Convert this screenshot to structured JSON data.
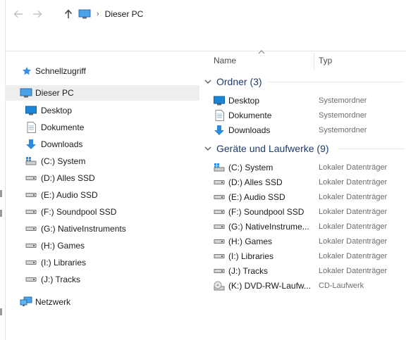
{
  "toolbar": {
    "back_label": "←",
    "forward_label": "→",
    "up_label": "↑",
    "separator": "›",
    "breadcrumb": "Dieser PC"
  },
  "nav": {
    "quick_access": "Schnellzugriff",
    "this_pc": "Dieser PC",
    "items": [
      {
        "label": "Desktop",
        "icon": "desktop-icon"
      },
      {
        "label": "Dokumente",
        "icon": "document-icon"
      },
      {
        "label": "Downloads",
        "icon": "download-icon"
      },
      {
        "label": "(C:) System",
        "icon": "system-drive-icon"
      },
      {
        "label": "(D:) Alles SSD",
        "icon": "drive-icon"
      },
      {
        "label": "(E:) Audio SSD",
        "icon": "drive-icon"
      },
      {
        "label": "(F:) Soundpool SSD",
        "icon": "drive-icon"
      },
      {
        "label": "(G:) NativeInstruments",
        "icon": "drive-icon"
      },
      {
        "label": "(H:) Games",
        "icon": "drive-icon"
      },
      {
        "label": "(I:) Libraries",
        "icon": "drive-icon"
      },
      {
        "label": "(J:) Tracks",
        "icon": "drive-icon"
      }
    ],
    "network": "Netzwerk"
  },
  "columns": {
    "name": "Name",
    "type": "Typ"
  },
  "groups": {
    "folders": {
      "title": "Ordner (3)",
      "rows": [
        {
          "name": "Desktop",
          "type": "Systemordner",
          "icon": "desktop-icon"
        },
        {
          "name": "Dokumente",
          "type": "Systemordner",
          "icon": "document-icon"
        },
        {
          "name": "Downloads",
          "type": "Systemordner",
          "icon": "download-icon"
        }
      ]
    },
    "drives": {
      "title": "Geräte und Laufwerke (9)",
      "rows": [
        {
          "name": "(C:) System",
          "type": "Lokaler Datenträger",
          "icon": "system-drive-icon"
        },
        {
          "name": "(D:) Alles SSD",
          "type": "Lokaler Datenträger",
          "icon": "drive-icon"
        },
        {
          "name": "(E:) Audio SSD",
          "type": "Lokaler Datenträger",
          "icon": "drive-icon"
        },
        {
          "name": "(F:) Soundpool SSD",
          "type": "Lokaler Datenträger",
          "icon": "drive-icon"
        },
        {
          "name": "(G:) NativeInstrume...",
          "type": "Lokaler Datenträger",
          "icon": "drive-icon"
        },
        {
          "name": "(H:) Games",
          "type": "Lokaler Datenträger",
          "icon": "drive-icon"
        },
        {
          "name": "(I:) Libraries",
          "type": "Lokaler Datenträger",
          "icon": "drive-icon"
        },
        {
          "name": "(J:) Tracks",
          "type": "Lokaler Datenträger",
          "icon": "drive-icon"
        },
        {
          "name": "(K:) DVD-RW-Laufw...",
          "type": "CD-Laufwerk",
          "icon": "dvd-drive-icon"
        }
      ]
    }
  },
  "colors": {
    "selection": "#eeeeee",
    "group_title": "#1e3b6b",
    "accent_blue": "#1a86d9"
  }
}
